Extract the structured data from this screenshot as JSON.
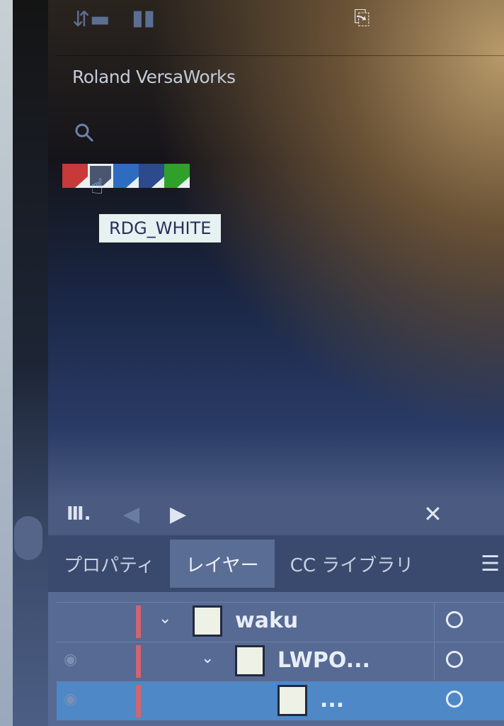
{
  "swatch_panel": {
    "library_title": "Roland VersaWorks",
    "swatches": [
      {
        "name": "red",
        "color": "#c83a3a"
      },
      {
        "name": "RDG_WHITE",
        "color": "#4a5670"
      },
      {
        "name": "blue",
        "color": "#2f6cc0"
      },
      {
        "name": "navy",
        "color": "#2c4a8c"
      },
      {
        "name": "green",
        "color": "#2fa02a"
      }
    ],
    "tooltip": "RDG_WHITE"
  },
  "tabs": [
    {
      "label": "プロパティ",
      "active": false
    },
    {
      "label": "レイヤー",
      "active": true
    },
    {
      "label": "CC ライブラリ",
      "active": false
    }
  ],
  "layers": [
    {
      "name": "waku",
      "depth": 0,
      "expanded": true,
      "visible": false,
      "selected": false
    },
    {
      "name": "LWPO...",
      "depth": 1,
      "expanded": true,
      "visible": true,
      "selected": false
    },
    {
      "name": "...",
      "depth": 2,
      "expanded": false,
      "visible": true,
      "selected": true
    }
  ]
}
